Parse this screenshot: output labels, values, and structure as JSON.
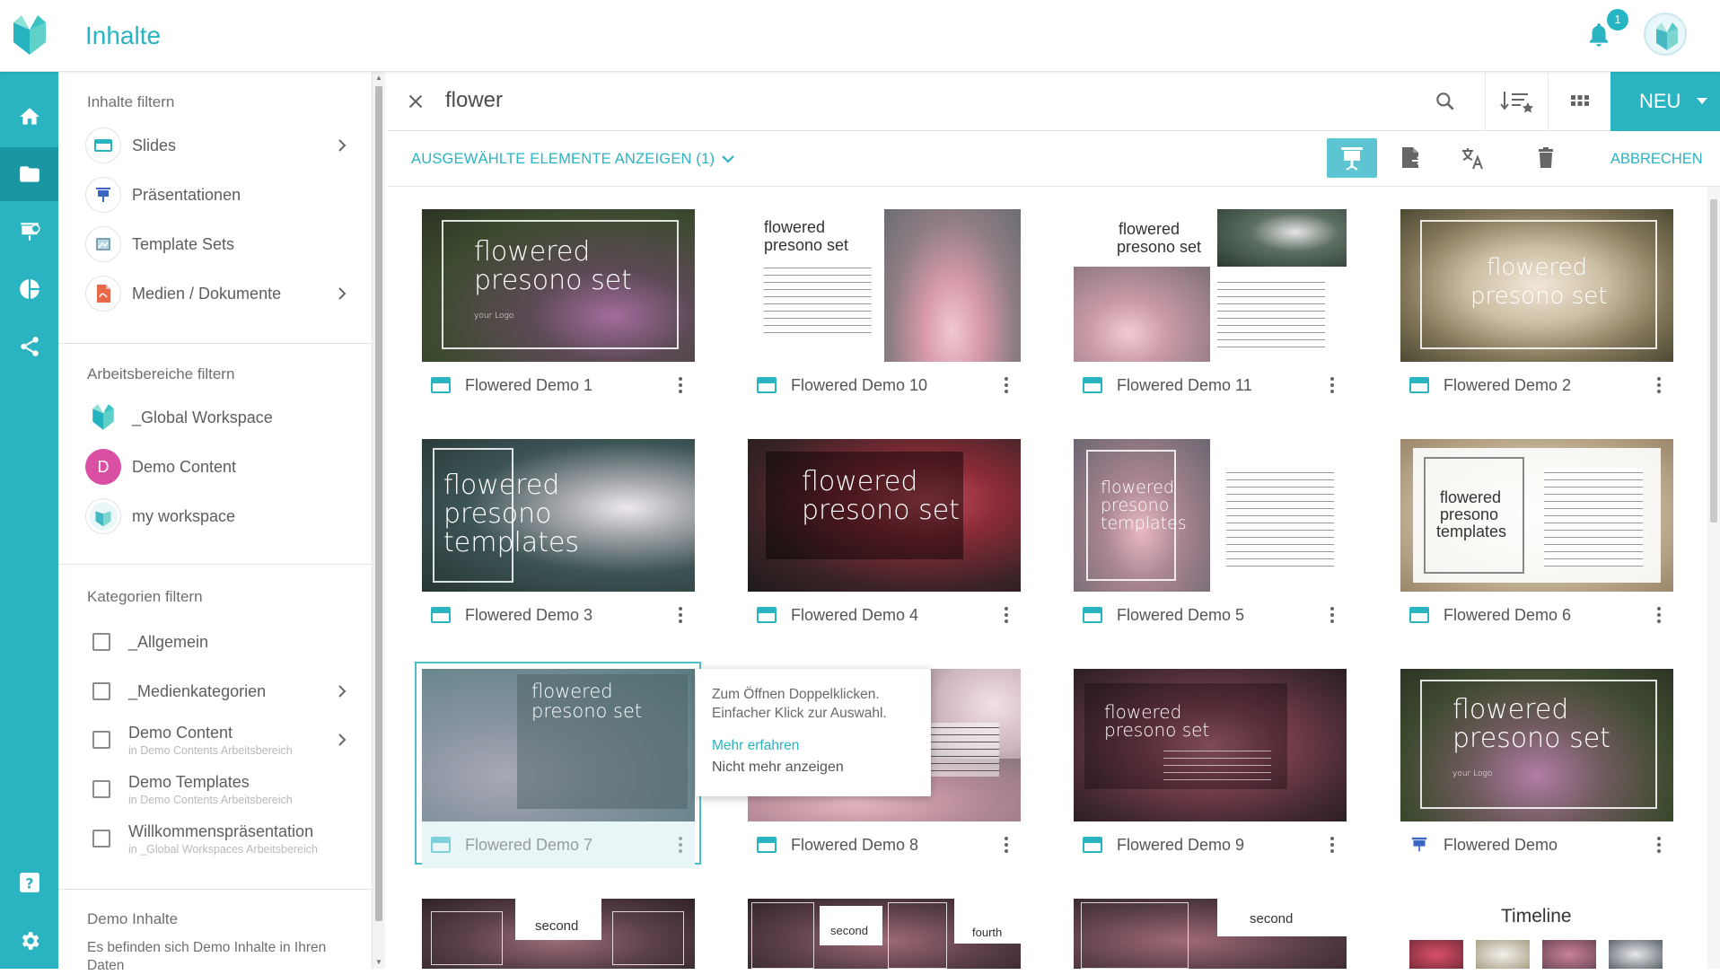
{
  "app": {
    "title": "Inhalte",
    "notification_count": "1"
  },
  "search": {
    "query": "flower"
  },
  "toolbar": {
    "new_label": "NEU"
  },
  "selection": {
    "show_selected_label": "AUSGEWÄHLTE ELEMENTE ANZEIGEN (1)",
    "cancel_label": "ABBRECHEN"
  },
  "sidebar": {
    "content_filter_title": "Inhalte filtern",
    "content_items": [
      {
        "label": "Slides",
        "icon": "slide-icon"
      },
      {
        "label": "Präsentationen",
        "icon": "presentation-icon"
      },
      {
        "label": "Template Sets",
        "icon": "template-icon"
      },
      {
        "label": "Medien / Dokumente",
        "icon": "media-icon"
      }
    ],
    "workspace_filter_title": "Arbeitsbereiche filtern",
    "workspaces": [
      {
        "label": "_Global Workspace"
      },
      {
        "label": "Demo Content",
        "initial": "D"
      },
      {
        "label": "my workspace"
      }
    ],
    "category_filter_title": "Kategorien filtern",
    "categories": [
      {
        "label": "_Allgemein",
        "sub": ""
      },
      {
        "label": "_Medienkategorien",
        "sub": ""
      },
      {
        "label": "Demo Content",
        "sub": "in Demo Contents Arbeitsbereich"
      },
      {
        "label": "Demo Templates",
        "sub": "in Demo Contents Arbeitsbereich"
      },
      {
        "label": "Willkommenspräsentation",
        "sub": "in _Global Workspaces Arbeitsbereich"
      }
    ],
    "demo_title": "Demo Inhalte",
    "demo_text": "Es befinden sich Demo Inhalte in Ihren Daten"
  },
  "cards": [
    {
      "name": "Flowered Demo 1"
    },
    {
      "name": "Flowered Demo 10"
    },
    {
      "name": "Flowered Demo 11"
    },
    {
      "name": "Flowered Demo 2"
    },
    {
      "name": "Flowered Demo 3"
    },
    {
      "name": "Flowered Demo 4"
    },
    {
      "name": "Flowered Demo 5"
    },
    {
      "name": "Flowered Demo 6"
    },
    {
      "name": "Flowered Demo 7"
    },
    {
      "name": "Flowered Demo 8"
    },
    {
      "name": "Flowered Demo 9"
    },
    {
      "name": "Flowered Demo"
    }
  ],
  "thumbs": {
    "flowered": "flowered",
    "presono_set": "presono set",
    "presono": "presono",
    "templates": "templates",
    "your_logo": "your Logo",
    "second": "second",
    "fourth": "fourth",
    "timeline": "Timeline"
  },
  "tooltip": {
    "line1": "Zum Öffnen Doppelklicken.",
    "line2": "Einfacher Klick zur Auswahl.",
    "learn_more": "Mehr erfahren",
    "dismiss": "Nicht mehr anzeigen"
  },
  "colors": {
    "accent": "#2ab3c0",
    "rail": "#2ab3c0",
    "rail_active": "#1a96a3"
  }
}
